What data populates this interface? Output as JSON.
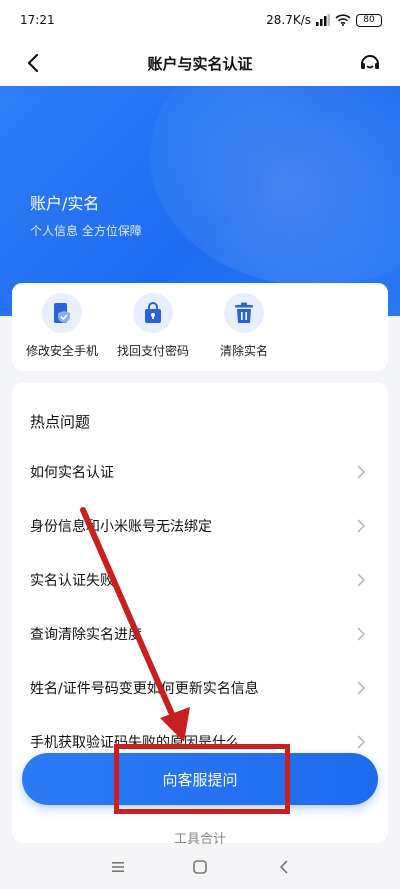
{
  "status_bar": {
    "time": "17:21",
    "network_speed": "28.7K/s",
    "battery": "80"
  },
  "nav": {
    "title": "账户与实名认证"
  },
  "hero": {
    "title": "账户/实名",
    "subtitle": "个人信息 全方位保障"
  },
  "actions": [
    {
      "label": "修改安全手机",
      "icon": "phone-shield-icon"
    },
    {
      "label": "找回支付密码",
      "icon": "lock-bag-icon"
    },
    {
      "label": "清除实名",
      "icon": "trash-icon"
    }
  ],
  "faq": {
    "header": "热点问题",
    "items": [
      "如何实名认证",
      "身份信息和小米账号无法绑定",
      "实名认证失败",
      "查询清除实名进度",
      "姓名/证件号码变更如何更新实名信息",
      "手机获取验证码失败的原因是什么"
    ]
  },
  "ask_button": {
    "label": "向客服提问"
  },
  "more": {
    "label": "工具合计"
  },
  "colors": {
    "accent": "#1f6cf0",
    "annotation": "#c8201f"
  }
}
